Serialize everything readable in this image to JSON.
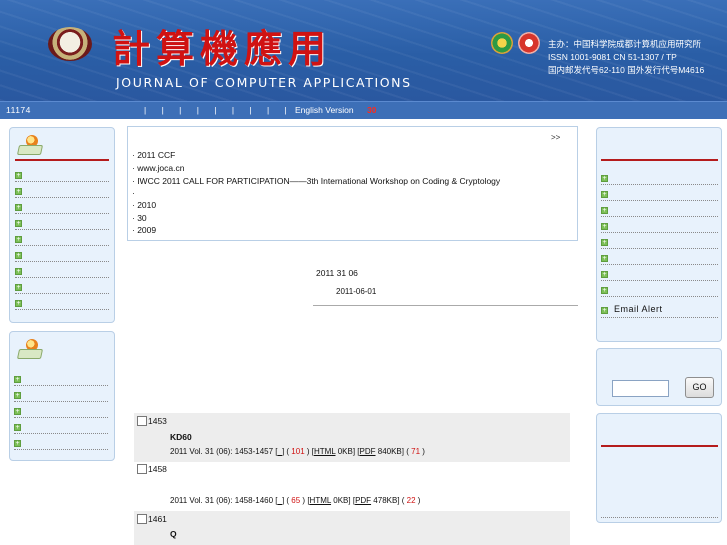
{
  "header": {
    "cn_title": "計算機應用",
    "en_title": "JOURNAL OF COMPUTER APPLICATIONS",
    "publisher": "主办：中国科学院成都计算机应用研究所",
    "issn": "ISSN 1001-9081    CN 51-1307 / TP",
    "codes": "国内邮发代号62-110  国外发行代号M4616"
  },
  "navbar": {
    "left": "11174",
    "separators": "| | | | | | | | |",
    "english": "English Version",
    "count": "30"
  },
  "news": {
    "more": ">>",
    "items": [
      "· 2011 CCF",
      "·       www.joca.cn",
      "· IWCC 2011 CALL FOR PARTICIPATION——3th International Workshop on Coding & Cryptology",
      "·",
      "·       2010",
      "·         30",
      "·            2009"
    ]
  },
  "issue": {
    "title": "2011  31  06",
    "date": "2011-06-01"
  },
  "right_box1": {
    "email_alert": "Email Alert"
  },
  "search": {
    "button": "GO"
  },
  "articles": [
    {
      "num": "1453",
      "title": "KD60",
      "meta_prefix": "2011 Vol. 31 (06): 1453-1457 [",
      "abstract_link": "_",
      "abs_count": "101",
      "html_link": "HTML",
      "html_size": "0KB",
      "pdf_link": "PDF",
      "pdf_size": "840KB",
      "pdf_count": "71"
    },
    {
      "num": "1458",
      "title": "",
      "meta_prefix": "2011 Vol. 31 (06): 1458-1460 [",
      "abstract_link": "_",
      "abs_count": "65",
      "html_link": "HTML",
      "html_size": "0KB",
      "pdf_link": "PDF",
      "pdf_size": "478KB",
      "pdf_count": "22"
    },
    {
      "num": "1461",
      "title": "Q"
    }
  ]
}
